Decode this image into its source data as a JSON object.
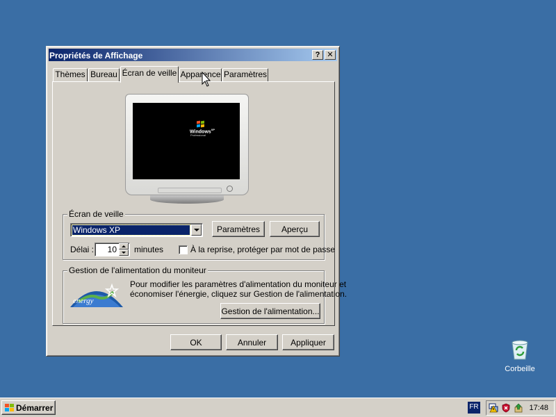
{
  "window": {
    "title": "Propriétés de Affichage",
    "help_label": "?",
    "close_label": "✕"
  },
  "tabs": [
    {
      "label": "Thèmes"
    },
    {
      "label": "Bureau"
    },
    {
      "label": "Écran de veille",
      "active": true
    },
    {
      "label": "Apparence"
    },
    {
      "label": "Paramètres"
    }
  ],
  "preview": {
    "logo_text": "Windows",
    "logo_superscript": "XP",
    "logo_subtitle": "Professional"
  },
  "screensaver": {
    "group_label": "Écran de veille",
    "selected": "Windows XP",
    "settings_button": "Paramètres",
    "preview_button": "Aperçu",
    "delay_label": "Délai :",
    "delay_value": "10",
    "delay_unit": "minutes",
    "password_checkbox_label": "À la reprise, protéger par mot de passe",
    "password_checked": false
  },
  "power": {
    "group_label": "Gestion de l'alimentation du moniteur",
    "description_line1": "Pour modifier les paramètres d'alimentation du moniteur et",
    "description_line2": "économiser l'énergie, cliquez sur Gestion de l'alimentation.",
    "button": "Gestion de l'alimentation...",
    "logo_text": "energy"
  },
  "footer": {
    "ok": "OK",
    "cancel": "Annuler",
    "apply": "Appliquer"
  },
  "desktop": {
    "recycle_bin_label": "Corbeille",
    "background_color": "#3a6ea5"
  },
  "taskbar": {
    "start_label": "Démarrer",
    "language": "FR",
    "clock": "17:48",
    "tray_icons": [
      "network-icon",
      "security-shield-icon",
      "updates-icon"
    ]
  }
}
